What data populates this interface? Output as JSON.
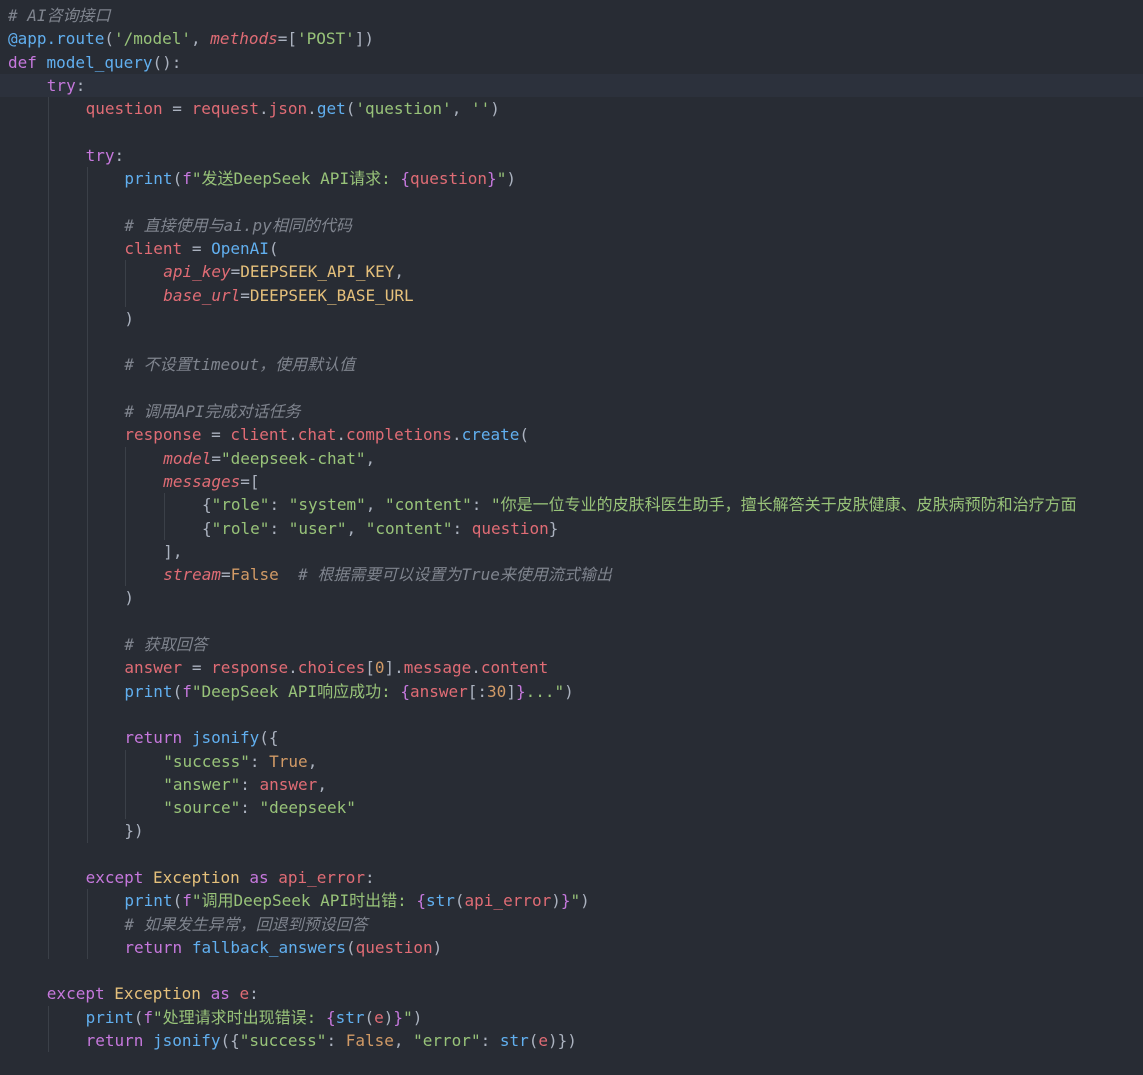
{
  "colors": {
    "background": "#282c34",
    "comment": "#7f848e",
    "keyword": "#c678dd",
    "function": "#61afef",
    "variable": "#e06c75",
    "string": "#98c379",
    "constant": "#d19a66",
    "class": "#e5c07b",
    "plain": "#abb2bf"
  },
  "code_lines": [
    {
      "indent": 0,
      "tokens": [
        {
          "t": "# AI咨询接口",
          "c": "comment"
        }
      ]
    },
    {
      "indent": 0,
      "tokens": [
        {
          "t": "@app.route",
          "c": "deco"
        },
        {
          "t": "(",
          "c": "plain"
        },
        {
          "t": "'/model'",
          "c": "string"
        },
        {
          "t": ", ",
          "c": "plain"
        },
        {
          "t": "methods",
          "c": "param"
        },
        {
          "t": "=[",
          "c": "plain"
        },
        {
          "t": "'POST'",
          "c": "string"
        },
        {
          "t": "])",
          "c": "plain"
        }
      ]
    },
    {
      "indent": 0,
      "tokens": [
        {
          "t": "def ",
          "c": "keyword"
        },
        {
          "t": "model_query",
          "c": "func"
        },
        {
          "t": "():",
          "c": "plain"
        }
      ]
    },
    {
      "indent": 1,
      "tokens": [
        {
          "t": "try",
          "c": "keyword"
        },
        {
          "t": ":",
          "c": "plain"
        }
      ]
    },
    {
      "indent": 2,
      "tokens": [
        {
          "t": "question",
          "c": "var"
        },
        {
          "t": " = ",
          "c": "plain"
        },
        {
          "t": "request",
          "c": "var"
        },
        {
          "t": ".",
          "c": "plain"
        },
        {
          "t": "json",
          "c": "var"
        },
        {
          "t": ".",
          "c": "plain"
        },
        {
          "t": "get",
          "c": "func"
        },
        {
          "t": "(",
          "c": "plain"
        },
        {
          "t": "'question'",
          "c": "string"
        },
        {
          "t": ", ",
          "c": "plain"
        },
        {
          "t": "''",
          "c": "string"
        },
        {
          "t": ")",
          "c": "plain"
        }
      ]
    },
    {
      "indent": 2,
      "tokens": []
    },
    {
      "indent": 2,
      "tokens": [
        {
          "t": "try",
          "c": "keyword"
        },
        {
          "t": ":",
          "c": "plain"
        }
      ]
    },
    {
      "indent": 3,
      "tokens": [
        {
          "t": "print",
          "c": "func"
        },
        {
          "t": "(",
          "c": "plain"
        },
        {
          "t": "f",
          "c": "keyword"
        },
        {
          "t": "\"发送DeepSeek API请求: ",
          "c": "string"
        },
        {
          "t": "{",
          "c": "keyword"
        },
        {
          "t": "question",
          "c": "var"
        },
        {
          "t": "}",
          "c": "keyword"
        },
        {
          "t": "\"",
          "c": "string"
        },
        {
          "t": ")",
          "c": "plain"
        }
      ]
    },
    {
      "indent": 3,
      "tokens": []
    },
    {
      "indent": 3,
      "tokens": [
        {
          "t": "# 直接使用与ai.py相同的代码",
          "c": "comment"
        }
      ]
    },
    {
      "indent": 3,
      "tokens": [
        {
          "t": "client",
          "c": "var"
        },
        {
          "t": " = ",
          "c": "plain"
        },
        {
          "t": "OpenAI",
          "c": "func"
        },
        {
          "t": "(",
          "c": "plain"
        }
      ]
    },
    {
      "indent": 4,
      "tokens": [
        {
          "t": "api_key",
          "c": "param"
        },
        {
          "t": "=",
          "c": "plain"
        },
        {
          "t": "DEEPSEEK_API_KEY",
          "c": "class"
        },
        {
          "t": ",",
          "c": "plain"
        }
      ]
    },
    {
      "indent": 4,
      "tokens": [
        {
          "t": "base_url",
          "c": "param"
        },
        {
          "t": "=",
          "c": "plain"
        },
        {
          "t": "DEEPSEEK_BASE_URL",
          "c": "class"
        }
      ]
    },
    {
      "indent": 3,
      "tokens": [
        {
          "t": ")",
          "c": "plain"
        }
      ]
    },
    {
      "indent": 3,
      "tokens": []
    },
    {
      "indent": 3,
      "tokens": [
        {
          "t": "# 不设置timeout，使用默认值",
          "c": "comment"
        }
      ]
    },
    {
      "indent": 3,
      "tokens": []
    },
    {
      "indent": 3,
      "tokens": [
        {
          "t": "# 调用API完成对话任务",
          "c": "comment"
        }
      ]
    },
    {
      "indent": 3,
      "tokens": [
        {
          "t": "response",
          "c": "var"
        },
        {
          "t": " = ",
          "c": "plain"
        },
        {
          "t": "client",
          "c": "var"
        },
        {
          "t": ".",
          "c": "plain"
        },
        {
          "t": "chat",
          "c": "var"
        },
        {
          "t": ".",
          "c": "plain"
        },
        {
          "t": "completions",
          "c": "var"
        },
        {
          "t": ".",
          "c": "plain"
        },
        {
          "t": "create",
          "c": "func"
        },
        {
          "t": "(",
          "c": "plain"
        }
      ]
    },
    {
      "indent": 4,
      "tokens": [
        {
          "t": "model",
          "c": "param"
        },
        {
          "t": "=",
          "c": "plain"
        },
        {
          "t": "\"deepseek-chat\"",
          "c": "string"
        },
        {
          "t": ",",
          "c": "plain"
        }
      ]
    },
    {
      "indent": 4,
      "tokens": [
        {
          "t": "messages",
          "c": "param"
        },
        {
          "t": "=[",
          "c": "plain"
        }
      ]
    },
    {
      "indent": 5,
      "tokens": [
        {
          "t": "{",
          "c": "plain"
        },
        {
          "t": "\"role\"",
          "c": "string"
        },
        {
          "t": ": ",
          "c": "plain"
        },
        {
          "t": "\"system\"",
          "c": "string"
        },
        {
          "t": ", ",
          "c": "plain"
        },
        {
          "t": "\"content\"",
          "c": "string"
        },
        {
          "t": ": ",
          "c": "plain"
        },
        {
          "t": "\"你是一位专业的皮肤科医生助手，擅长解答关于皮肤健康、皮肤病预防和治疗方面",
          "c": "string"
        }
      ]
    },
    {
      "indent": 5,
      "tokens": [
        {
          "t": "{",
          "c": "plain"
        },
        {
          "t": "\"role\"",
          "c": "string"
        },
        {
          "t": ": ",
          "c": "plain"
        },
        {
          "t": "\"user\"",
          "c": "string"
        },
        {
          "t": ", ",
          "c": "plain"
        },
        {
          "t": "\"content\"",
          "c": "string"
        },
        {
          "t": ": ",
          "c": "plain"
        },
        {
          "t": "question",
          "c": "var"
        },
        {
          "t": "}",
          "c": "plain"
        }
      ]
    },
    {
      "indent": 4,
      "tokens": [
        {
          "t": "],",
          "c": "plain"
        }
      ]
    },
    {
      "indent": 4,
      "tokens": [
        {
          "t": "stream",
          "c": "param"
        },
        {
          "t": "=",
          "c": "plain"
        },
        {
          "t": "False",
          "c": "const"
        },
        {
          "t": "  ",
          "c": "plain"
        },
        {
          "t": "# 根据需要可以设置为True来使用流式输出",
          "c": "comment"
        }
      ]
    },
    {
      "indent": 3,
      "tokens": [
        {
          "t": ")",
          "c": "plain"
        }
      ]
    },
    {
      "indent": 3,
      "tokens": []
    },
    {
      "indent": 3,
      "tokens": [
        {
          "t": "# 获取回答",
          "c": "comment"
        }
      ]
    },
    {
      "indent": 3,
      "tokens": [
        {
          "t": "answer",
          "c": "var"
        },
        {
          "t": " = ",
          "c": "plain"
        },
        {
          "t": "response",
          "c": "var"
        },
        {
          "t": ".",
          "c": "plain"
        },
        {
          "t": "choices",
          "c": "var"
        },
        {
          "t": "[",
          "c": "plain"
        },
        {
          "t": "0",
          "c": "const"
        },
        {
          "t": "].",
          "c": "plain"
        },
        {
          "t": "message",
          "c": "var"
        },
        {
          "t": ".",
          "c": "plain"
        },
        {
          "t": "content",
          "c": "var"
        }
      ]
    },
    {
      "indent": 3,
      "tokens": [
        {
          "t": "print",
          "c": "func"
        },
        {
          "t": "(",
          "c": "plain"
        },
        {
          "t": "f",
          "c": "keyword"
        },
        {
          "t": "\"DeepSeek API响应成功: ",
          "c": "string"
        },
        {
          "t": "{",
          "c": "keyword"
        },
        {
          "t": "answer",
          "c": "var"
        },
        {
          "t": "[:",
          "c": "plain"
        },
        {
          "t": "30",
          "c": "const"
        },
        {
          "t": "]",
          "c": "plain"
        },
        {
          "t": "}",
          "c": "keyword"
        },
        {
          "t": "...\"",
          "c": "string"
        },
        {
          "t": ")",
          "c": "plain"
        }
      ]
    },
    {
      "indent": 3,
      "tokens": []
    },
    {
      "indent": 3,
      "tokens": [
        {
          "t": "return ",
          "c": "keyword"
        },
        {
          "t": "jsonify",
          "c": "func"
        },
        {
          "t": "({",
          "c": "plain"
        }
      ]
    },
    {
      "indent": 4,
      "tokens": [
        {
          "t": "\"success\"",
          "c": "string"
        },
        {
          "t": ": ",
          "c": "plain"
        },
        {
          "t": "True",
          "c": "const"
        },
        {
          "t": ",",
          "c": "plain"
        }
      ]
    },
    {
      "indent": 4,
      "tokens": [
        {
          "t": "\"answer\"",
          "c": "string"
        },
        {
          "t": ": ",
          "c": "plain"
        },
        {
          "t": "answer",
          "c": "var"
        },
        {
          "t": ",",
          "c": "plain"
        }
      ]
    },
    {
      "indent": 4,
      "tokens": [
        {
          "t": "\"source\"",
          "c": "string"
        },
        {
          "t": ": ",
          "c": "plain"
        },
        {
          "t": "\"deepseek\"",
          "c": "string"
        }
      ]
    },
    {
      "indent": 3,
      "tokens": [
        {
          "t": "})",
          "c": "plain"
        }
      ]
    },
    {
      "indent": 2,
      "tokens": []
    },
    {
      "indent": 2,
      "tokens": [
        {
          "t": "except ",
          "c": "keyword"
        },
        {
          "t": "Exception",
          "c": "class"
        },
        {
          "t": " as ",
          "c": "keyword"
        },
        {
          "t": "api_error",
          "c": "var"
        },
        {
          "t": ":",
          "c": "plain"
        }
      ]
    },
    {
      "indent": 3,
      "tokens": [
        {
          "t": "print",
          "c": "func"
        },
        {
          "t": "(",
          "c": "plain"
        },
        {
          "t": "f",
          "c": "keyword"
        },
        {
          "t": "\"调用DeepSeek API时出错: ",
          "c": "string"
        },
        {
          "t": "{",
          "c": "keyword"
        },
        {
          "t": "str",
          "c": "func"
        },
        {
          "t": "(",
          "c": "plain"
        },
        {
          "t": "api_error",
          "c": "var"
        },
        {
          "t": ")",
          "c": "plain"
        },
        {
          "t": "}",
          "c": "keyword"
        },
        {
          "t": "\"",
          "c": "string"
        },
        {
          "t": ")",
          "c": "plain"
        }
      ]
    },
    {
      "indent": 3,
      "tokens": [
        {
          "t": "# 如果发生异常，回退到预设回答",
          "c": "comment"
        }
      ]
    },
    {
      "indent": 3,
      "tokens": [
        {
          "t": "return ",
          "c": "keyword"
        },
        {
          "t": "fallback_answers",
          "c": "func"
        },
        {
          "t": "(",
          "c": "plain"
        },
        {
          "t": "question",
          "c": "var"
        },
        {
          "t": ")",
          "c": "plain"
        }
      ]
    },
    {
      "indent": 1,
      "tokens": []
    },
    {
      "indent": 1,
      "tokens": [
        {
          "t": "except ",
          "c": "keyword"
        },
        {
          "t": "Exception",
          "c": "class"
        },
        {
          "t": " as ",
          "c": "keyword"
        },
        {
          "t": "e",
          "c": "var"
        },
        {
          "t": ":",
          "c": "plain"
        }
      ]
    },
    {
      "indent": 2,
      "tokens": [
        {
          "t": "print",
          "c": "func"
        },
        {
          "t": "(",
          "c": "plain"
        },
        {
          "t": "f",
          "c": "keyword"
        },
        {
          "t": "\"处理请求时出现错误: ",
          "c": "string"
        },
        {
          "t": "{",
          "c": "keyword"
        },
        {
          "t": "str",
          "c": "func"
        },
        {
          "t": "(",
          "c": "plain"
        },
        {
          "t": "e",
          "c": "var"
        },
        {
          "t": ")",
          "c": "plain"
        },
        {
          "t": "}",
          "c": "keyword"
        },
        {
          "t": "\"",
          "c": "string"
        },
        {
          "t": ")",
          "c": "plain"
        }
      ]
    },
    {
      "indent": 2,
      "tokens": [
        {
          "t": "return ",
          "c": "keyword"
        },
        {
          "t": "jsonify",
          "c": "func"
        },
        {
          "t": "({",
          "c": "plain"
        },
        {
          "t": "\"success\"",
          "c": "string"
        },
        {
          "t": ": ",
          "c": "plain"
        },
        {
          "t": "False",
          "c": "const"
        },
        {
          "t": ", ",
          "c": "plain"
        },
        {
          "t": "\"error\"",
          "c": "string"
        },
        {
          "t": ": ",
          "c": "plain"
        },
        {
          "t": "str",
          "c": "func"
        },
        {
          "t": "(",
          "c": "plain"
        },
        {
          "t": "e",
          "c": "var"
        },
        {
          "t": ")})",
          "c": "plain"
        }
      ]
    }
  ]
}
